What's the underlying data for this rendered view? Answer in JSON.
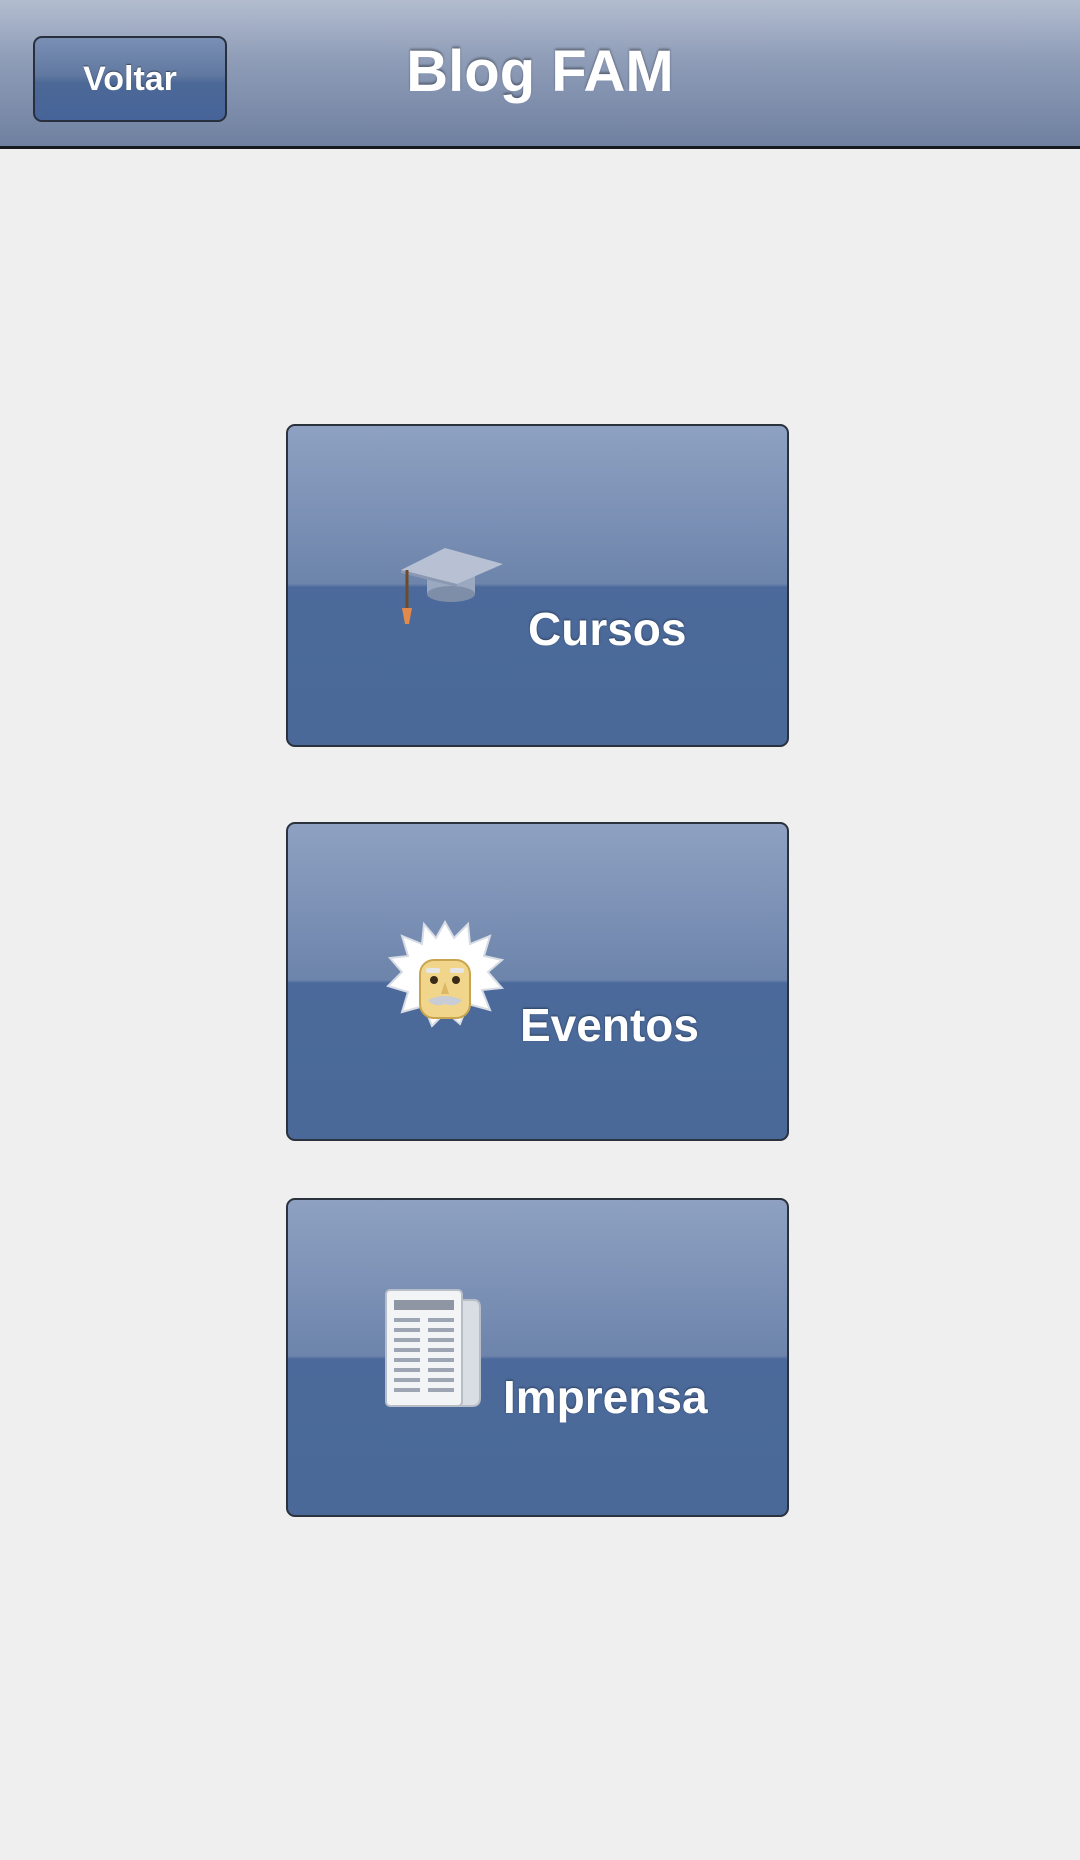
{
  "header": {
    "title": "Blog FAM",
    "back_label": "Voltar"
  },
  "menu": [
    {
      "label": "Cursos",
      "icon": "graduation-cap-icon"
    },
    {
      "label": "Eventos",
      "icon": "scientist-face-icon"
    },
    {
      "label": "Imprensa",
      "icon": "newspaper-icon"
    }
  ],
  "colors": {
    "background": "#efefef",
    "header_gradient_top": "#b3bdcf",
    "header_gradient_bottom": "#6f80a0",
    "button_blue": "#4b6a9b",
    "text": "#ffffff"
  }
}
